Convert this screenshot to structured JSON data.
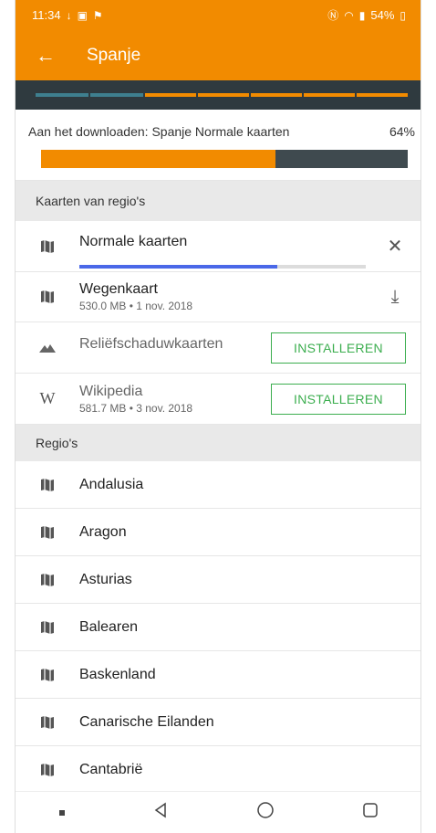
{
  "status_bar": {
    "time": "11:34",
    "battery": "54%"
  },
  "app_bar": {
    "title": "Spanje"
  },
  "download": {
    "label": "Aan het downloaden: Spanje Normale kaarten",
    "percent_text": "64%",
    "progress": 0.64
  },
  "sections": {
    "maps": "Kaarten van regio's",
    "regions": "Regio's"
  },
  "maps": [
    {
      "name": "Normale kaarten",
      "sub": "",
      "progress": 0.69,
      "action": "close-icon"
    },
    {
      "name": "Wegenkaart",
      "sub": "530.0 MB • 1 nov. 2018",
      "action": "download-icon"
    },
    {
      "name": "Reliëfschaduwkaarten",
      "sub": "",
      "button": "INSTALLEREN"
    },
    {
      "name": "Wikipedia",
      "sub": "581.7 MB • 3 nov. 2018",
      "button": "INSTALLEREN"
    }
  ],
  "regions": [
    "Andalusia",
    "Aragon",
    "Asturias",
    "Balearen",
    "Baskenland",
    "Canarische Eilanden",
    "Cantabrië"
  ],
  "colors": {
    "accent": "#f28b00",
    "dark": "#2f3a3f",
    "install_green": "#3cae4f",
    "progress_blue": "#4a68e8"
  }
}
